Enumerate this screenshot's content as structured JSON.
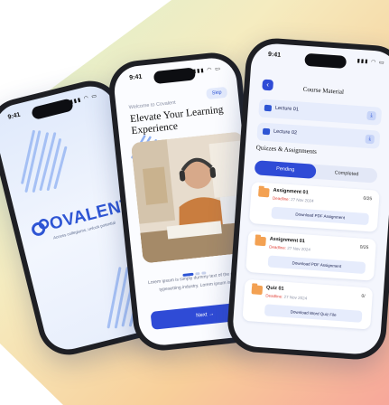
{
  "colors": {
    "accent": "#2f4bd6",
    "brand": "#2e55d4",
    "deadline": "#e2453c",
    "folder": "#f3a152"
  },
  "splash": {
    "time": "9:41",
    "status_icons": "▮▮▮ ◠ ▭",
    "brand": "OVALENT",
    "tagline": "Access collegiums, unlock potential"
  },
  "onboarding": {
    "time": "9:41",
    "status_icons": "▮▮▮ ◠ ▭",
    "welcome": "Welcome to Covalent",
    "skip": "Skip",
    "headline": "Elevate Your Learning Experience",
    "body": "Lorem ipsum is simply dummy text of the printing and typesetting industry. Lorem ipsum is simply",
    "next_label": "Next →"
  },
  "course": {
    "time": "9:41",
    "status_icons": "▮▮▮ ◠ ▭",
    "back_icon": "‹",
    "title": "Course Material",
    "lectures": [
      {
        "label": "Lecture 01",
        "action_icon": "⤓"
      },
      {
        "label": "Lecture 02",
        "action_icon": "⤓"
      }
    ],
    "section_title": "Quizzes & Assignments",
    "tabs": {
      "pending": "Pending",
      "completed": "Completed"
    },
    "items": [
      {
        "title": "Assignment 01",
        "deadline_label": "Deadline:",
        "deadline": "27 Nov 2024",
        "score": "0/25",
        "action": "Download PDF Assignment"
      },
      {
        "title": "Assignment 01",
        "deadline_label": "Deadline:",
        "deadline": "27 Nov 2024",
        "score": "0/25",
        "action": "Download PDF Assignment"
      },
      {
        "title": "Quiz 01",
        "deadline_label": "Deadline:",
        "deadline": "27 Nov 2024",
        "score": "0/",
        "action": "Download Word Quiz File"
      }
    ]
  }
}
